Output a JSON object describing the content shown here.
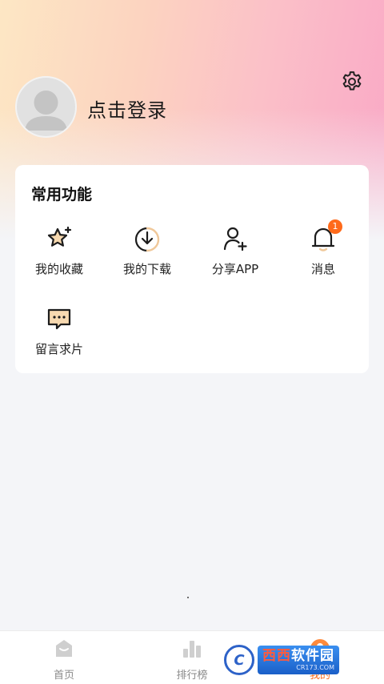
{
  "header": {
    "login_text": "点击登录",
    "settings_icon": "gear-icon",
    "avatar_icon": "default-avatar-icon"
  },
  "common": {
    "title": "常用功能",
    "items": [
      {
        "label": "我的收藏",
        "icon": "star-sparkle-icon"
      },
      {
        "label": "我的下载",
        "icon": "download-circle-icon"
      },
      {
        "label": "分享APP",
        "icon": "add-user-icon"
      },
      {
        "label": "消息",
        "icon": "bell-icon",
        "badge": "1"
      },
      {
        "label": "留言求片",
        "icon": "chat-bubble-icon"
      }
    ]
  },
  "tabs": [
    {
      "label": "首页",
      "icon": "home-icon"
    },
    {
      "label": "排行榜",
      "icon": "bar-chart-icon"
    },
    {
      "label": "我的",
      "icon": "profile-icon",
      "active": true
    }
  ],
  "watermark": {
    "logo_letter": "C",
    "text_part1": "西西",
    "text_part2": "软件园",
    "subtext": "CR173.COM"
  },
  "colors": {
    "accent": "#ff6a1a",
    "badge": "#ff6a1a",
    "card_bg": "#ffffff",
    "page_bg": "#f4f5f8"
  }
}
